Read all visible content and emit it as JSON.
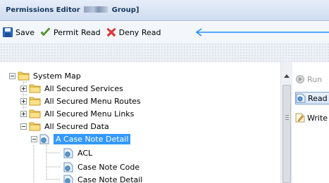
{
  "window": {
    "title_prefix": "Permissions Editor",
    "title_suffix": "Group]"
  },
  "toolbar": {
    "save_label": "Save",
    "permit_label": "Permit",
    "permit_read_label": "Read",
    "deny_label": "Deny",
    "deny_read_label": "Read"
  },
  "tree": {
    "root": "System Map",
    "services": "All Secured Services",
    "menu_routes": "All Secured Menu Routes",
    "menu_links": "All Secured Menu Links",
    "data": "All Secured Data",
    "selected": "A Case Note Detail",
    "child_1": "ACL",
    "child_2": "Case Note Code",
    "child_3": "Case Note Detail"
  },
  "permissions": {
    "run": "Run",
    "read": "Read",
    "write": "Write"
  },
  "colors": {
    "selection": "#3399ff",
    "arrow": "#1e90ff",
    "deny": "#e53935",
    "permit": "#5aa02c"
  }
}
